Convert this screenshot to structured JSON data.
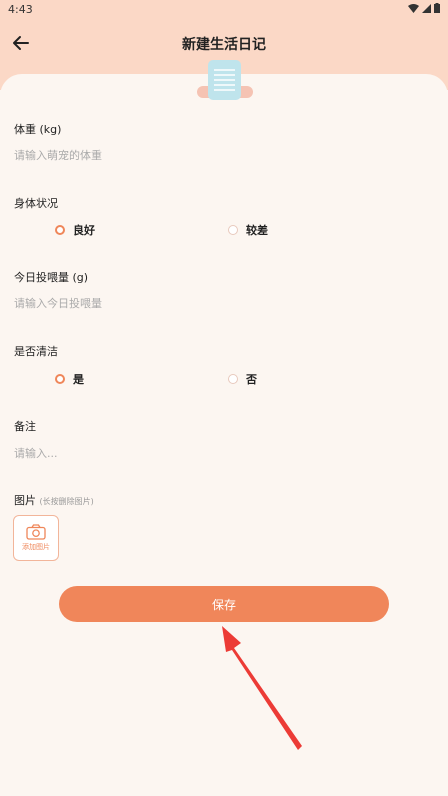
{
  "status": {
    "time": "4:43"
  },
  "header": {
    "title": "新建生活日记"
  },
  "form": {
    "weight": {
      "label": "体重 (kg)",
      "placeholder": "请输入萌宠的体重"
    },
    "condition": {
      "label": "身体状况",
      "options": [
        "良好",
        "较差"
      ],
      "selected": "良好"
    },
    "feeding": {
      "label": "今日投喂量 (g)",
      "placeholder": "请输入今日投喂量"
    },
    "clean": {
      "label": "是否清洁",
      "options": [
        "是",
        "否"
      ],
      "selected": "是"
    },
    "note": {
      "label": "备注",
      "placeholder": "请输入..."
    },
    "images": {
      "label": "图片",
      "hint": "(长按删除图片)",
      "add_label": "添加图片"
    }
  },
  "actions": {
    "save_label": "保存"
  },
  "colors": {
    "accent": "#f0865a",
    "header_bg": "#fbd8c6",
    "card_bg": "#fcf6f1",
    "icon_blue": "#bfe4ec"
  },
  "icons": [
    "back-arrow-icon",
    "notepad-icon",
    "camera-icon",
    "wifi-icon",
    "signal-icon",
    "battery-icon",
    "red-arrow-annotation"
  ]
}
